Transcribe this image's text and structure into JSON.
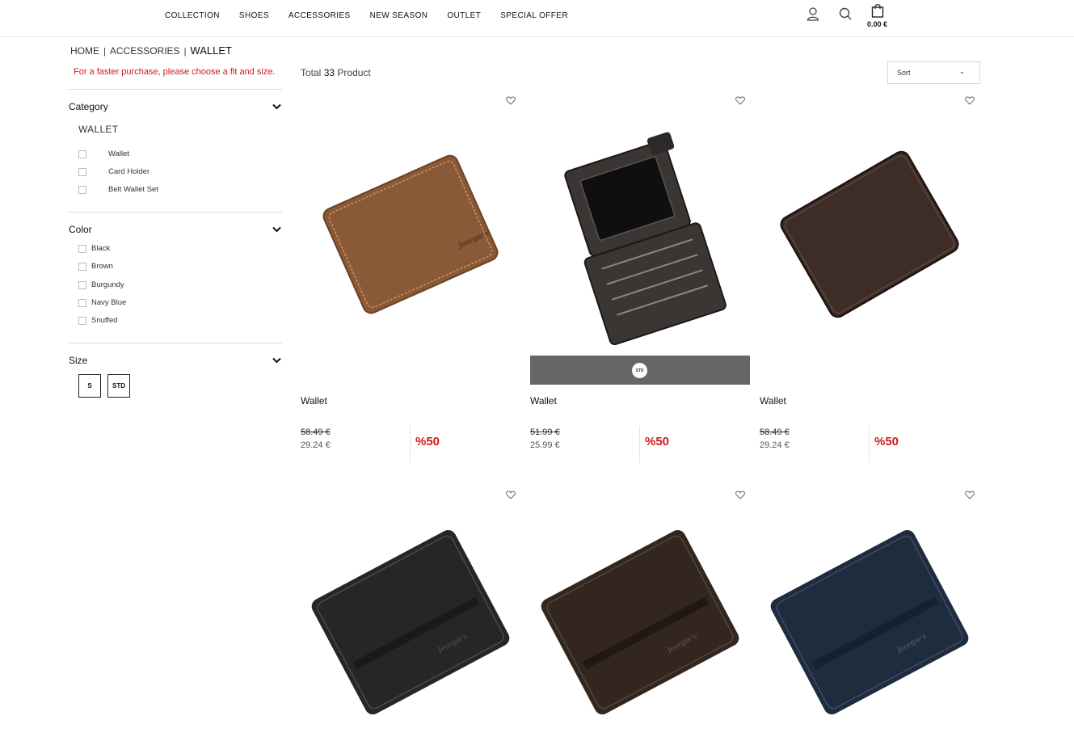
{
  "header": {
    "nav": [
      "COLLECTION",
      "SHOES",
      "ACCESSORIES",
      "NEW SEASON",
      "OUTLET",
      "SPECIAL OFFER"
    ],
    "icons": [
      "user-icon",
      "search-icon",
      "bag-icon"
    ],
    "cart_total": "0.00 €"
  },
  "breadcrumb": {
    "home": "HOME",
    "sep": "|",
    "accessories": "ACCESSORIES",
    "current": "WALLET"
  },
  "hint": "For a faster purchase, please choose a fit and size.",
  "filters": {
    "category": {
      "title": "Category",
      "subcategory": "WALLET",
      "options": [
        "Wallet",
        "Card Holder",
        "Belt Wallet Set"
      ]
    },
    "color": {
      "title": "Color",
      "options": [
        "Black",
        "Brown",
        "Burgundy",
        "Navy Blue",
        "Snuffed"
      ]
    },
    "size": {
      "title": "Size",
      "options": [
        "S",
        "STD"
      ]
    }
  },
  "listing": {
    "total_prefix": "Total",
    "total_count": "33",
    "total_suffix": "Product",
    "sort_label": "Sort"
  },
  "products": [
    {
      "name": "Wallet",
      "old_price": "58.49 €",
      "new_price": "29.24 €",
      "discount": "%50",
      "color": "#8a5a38",
      "style": "bifold-tan"
    },
    {
      "name": "Wallet",
      "old_price": "51.99 €",
      "new_price": "25.99 €",
      "discount": "%50",
      "color": "#3b3633",
      "style": "open",
      "size_chip": "STD"
    },
    {
      "name": "Wallet",
      "old_price": "58.49 €",
      "new_price": "29.24 €",
      "discount": "%50",
      "color": "#3e2c26",
      "style": "cardholder"
    },
    {
      "name": "",
      "color": "#262626",
      "style": "bifold"
    },
    {
      "name": "",
      "color": "#33261f",
      "style": "bifold"
    },
    {
      "name": "",
      "color": "#1f2c3e",
      "style": "bifold"
    }
  ]
}
